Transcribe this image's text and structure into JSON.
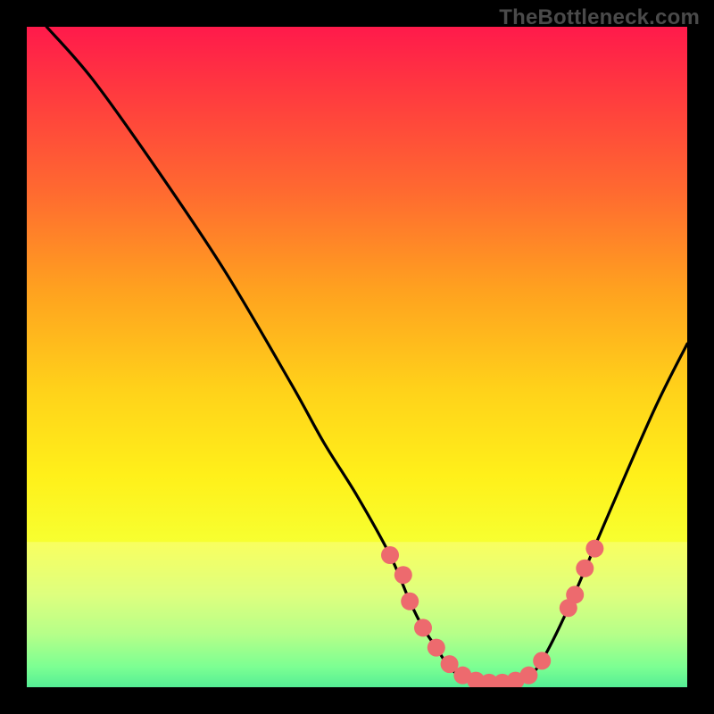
{
  "watermark": "TheBottleneck.com",
  "chart_data": {
    "type": "line",
    "title": "",
    "xlabel": "",
    "ylabel": "",
    "xlim": [
      0,
      100
    ],
    "ylim": [
      0,
      100
    ],
    "curve": {
      "x": [
        3,
        10,
        20,
        30,
        40,
        45,
        50,
        55,
        58,
        60,
        62,
        64,
        66,
        68,
        70,
        72,
        74,
        76,
        78,
        82,
        88,
        95,
        100
      ],
      "y": [
        100,
        92,
        78,
        63,
        46,
        37,
        29,
        20,
        13,
        9,
        6,
        3,
        1.5,
        0.9,
        0.6,
        0.6,
        0.9,
        1.8,
        4,
        12,
        26,
        42,
        52
      ]
    },
    "mask_band": {
      "y0": 22,
      "y1": 0
    },
    "markers": [
      {
        "x": 55,
        "y": 20
      },
      {
        "x": 57,
        "y": 17
      },
      {
        "x": 58,
        "y": 13
      },
      {
        "x": 60,
        "y": 9
      },
      {
        "x": 62,
        "y": 6
      },
      {
        "x": 64,
        "y": 3.5
      },
      {
        "x": 66,
        "y": 1.8
      },
      {
        "x": 68,
        "y": 1.0
      },
      {
        "x": 70,
        "y": 0.7
      },
      {
        "x": 72,
        "y": 0.7
      },
      {
        "x": 74,
        "y": 1.0
      },
      {
        "x": 76,
        "y": 1.8
      },
      {
        "x": 78,
        "y": 4
      },
      {
        "x": 82,
        "y": 12
      },
      {
        "x": 83,
        "y": 14
      },
      {
        "x": 84.5,
        "y": 18
      },
      {
        "x": 86,
        "y": 21
      }
    ],
    "marker_color": "#ed6a6e",
    "marker_radius": 10,
    "gradient_stops": [
      {
        "offset": 0.0,
        "color": "#ff1a4b"
      },
      {
        "offset": 0.1,
        "color": "#ff3a3f"
      },
      {
        "offset": 0.25,
        "color": "#ff6a30"
      },
      {
        "offset": 0.4,
        "color": "#ffa21f"
      },
      {
        "offset": 0.55,
        "color": "#ffd21a"
      },
      {
        "offset": 0.68,
        "color": "#fff01a"
      },
      {
        "offset": 0.78,
        "color": "#f7ff30"
      },
      {
        "offset": 0.86,
        "color": "#d3ff59"
      },
      {
        "offset": 0.92,
        "color": "#9dff67"
      },
      {
        "offset": 0.97,
        "color": "#4fff74"
      },
      {
        "offset": 1.0,
        "color": "#1ce877"
      }
    ]
  }
}
